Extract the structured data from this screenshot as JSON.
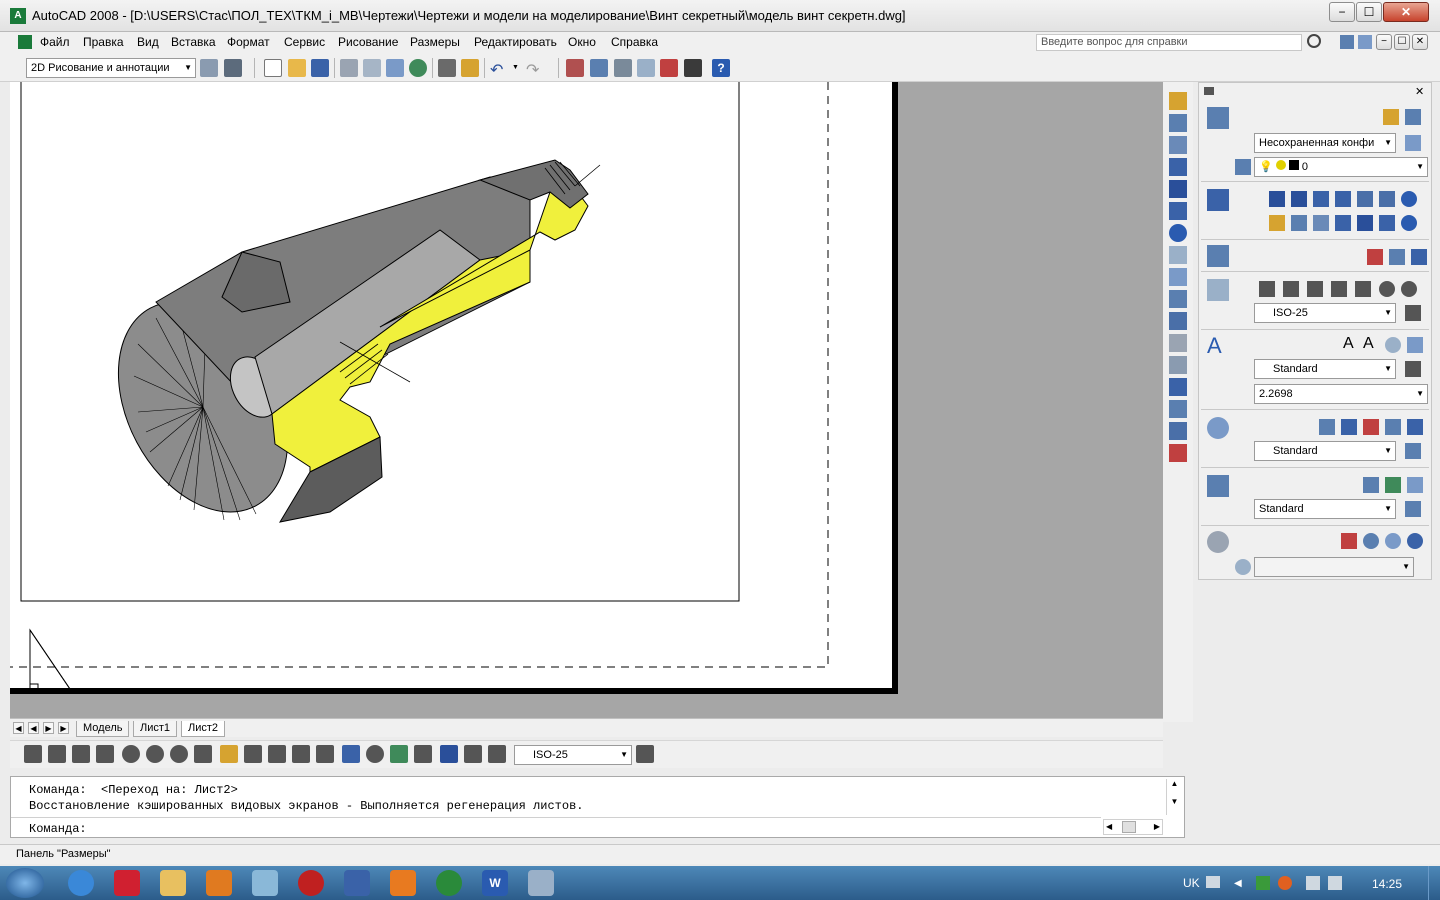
{
  "window": {
    "app_logo": "A",
    "title": "AutoCAD 2008 - [D:\\USERS\\Стас\\ПОЛ_ТЕХ\\ТКМ_i_МВ\\Чертежи\\Чертежи и модели на моделирование\\Винт секретный\\модель винт секретн.dwg]",
    "controls": {
      "minimize": "−",
      "maximize": "☐",
      "close": "✕"
    }
  },
  "menu": {
    "items": [
      "Файл",
      "Правка",
      "Вид",
      "Вставка",
      "Формат",
      "Сервис",
      "Рисование",
      "Размеры",
      "Редактировать",
      "Окно",
      "Справка"
    ],
    "help_placeholder": "Введите вопрос для справки"
  },
  "toolbar": {
    "workspace_combo": "2D Рисование и аннотации"
  },
  "tabs": {
    "items": [
      "Модель",
      "Лист1",
      "Лист2"
    ],
    "active": "Лист2"
  },
  "palette": {
    "layer_state_combo": "Несохраненная конфи",
    "layer_combo": "0",
    "dim_style_combo": "ISO-25",
    "text_style_combo": "Standard",
    "text_height_combo": "2.2698",
    "mleader_style_combo": "Standard",
    "table_style_combo": "Standard"
  },
  "dim_toolbar": {
    "style_combo": "ISO-25"
  },
  "command": {
    "line1": "Команда:  <Переход на: Лист2>",
    "line2": "Восстановление кэшированных видовых экранов - Выполняется регенерация листов.",
    "prompt": "Команда:"
  },
  "status": {
    "text": "Панель \"Размеры\""
  },
  "taskbar": {
    "language": "UK",
    "clock": "14:25"
  },
  "colors": {
    "section_fill": "#f0f03c",
    "body_fill": "#808080",
    "taskbar": "#2c5c8a"
  }
}
